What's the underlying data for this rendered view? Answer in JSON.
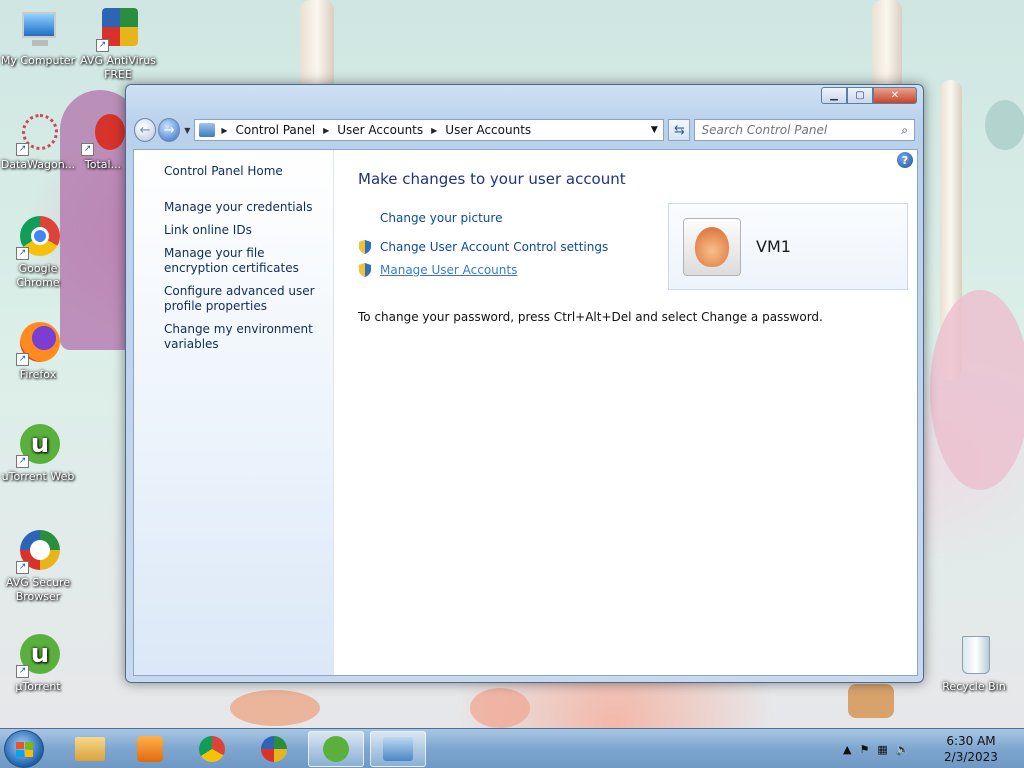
{
  "desktop": {
    "icons": [
      {
        "label": "My Computer"
      },
      {
        "label": "AVG AntiVirus FREE"
      },
      {
        "label": "DataWagon..."
      },
      {
        "label": "Total..."
      },
      {
        "label": "Google Chrome"
      },
      {
        "label": "Firefox"
      },
      {
        "label": "uTorrent Web"
      },
      {
        "label": "AVG Secure Browser"
      },
      {
        "label": "µTorrent"
      },
      {
        "label": "Recycle Bin"
      }
    ]
  },
  "window": {
    "address": {
      "crumbs": [
        "Control Panel",
        "User Accounts",
        "User Accounts"
      ]
    },
    "search_placeholder": "Search Control Panel",
    "sidebar": {
      "links": [
        "Control Panel Home",
        "Manage your credentials",
        "Link online IDs",
        "Manage your file encryption certificates",
        "Configure advanced user profile properties",
        "Change my environment variables"
      ]
    },
    "main": {
      "title": "Make changes to your user account",
      "tasks": [
        "Change your picture",
        "Change User Account Control settings",
        "Manage User Accounts"
      ],
      "note": "To change your password, press Ctrl+Alt+Del and select Change a password.",
      "user_name": "VM1"
    },
    "help_label": "?"
  },
  "taskbar": {
    "time": "6:30 AM",
    "date": "2/3/2023"
  },
  "colors": {
    "link": "#0b4a97",
    "title": "#1e3287",
    "taskbar": "#7ea6cf"
  }
}
